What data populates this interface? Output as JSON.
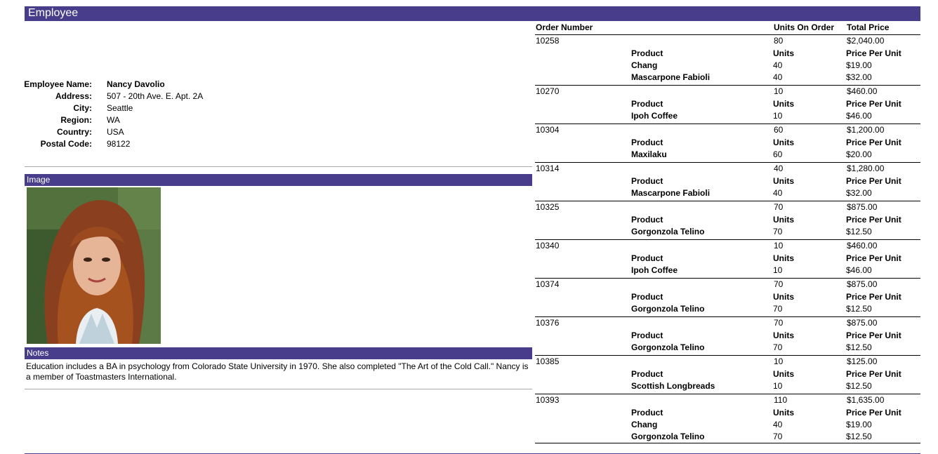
{
  "header": {
    "title": "Employee"
  },
  "employee": {
    "fields": [
      {
        "label": "Employee Name:",
        "value": "Nancy Davolio"
      },
      {
        "label": "Address:",
        "value": "507 - 20th Ave. E. Apt. 2A"
      },
      {
        "label": "City:",
        "value": "Seattle"
      },
      {
        "label": "Region:",
        "value": "WA"
      },
      {
        "label": "Country:",
        "value": "USA"
      },
      {
        "label": "Postal Code:",
        "value": "98122"
      }
    ]
  },
  "image_section": {
    "title": "Image"
  },
  "notes_section": {
    "title": "Notes",
    "text": "Education includes a BA in psychology from Colorado State University in 1970. She also completed \"The Art of the Cold Call.\" Nancy is a member of Toastmasters International."
  },
  "orders": {
    "headers": {
      "order_number": "Order Number",
      "units_on_order": "Units On Order",
      "total_price": "Total Price"
    },
    "detail_headers": {
      "product": "Product",
      "units": "Units",
      "price_per_unit": "Price Per Unit"
    },
    "list": [
      {
        "number": "10258",
        "units": "80",
        "total": "$2,040.00",
        "items": [
          {
            "product": "Chang",
            "units": "40",
            "price": "$19.00"
          },
          {
            "product": "Mascarpone Fabioli",
            "units": "40",
            "price": "$32.00"
          }
        ]
      },
      {
        "number": "10270",
        "units": "10",
        "total": "$460.00",
        "items": [
          {
            "product": "Ipoh Coffee",
            "units": "10",
            "price": "$46.00"
          }
        ]
      },
      {
        "number": "10304",
        "units": "60",
        "total": "$1,200.00",
        "items": [
          {
            "product": "Maxilaku",
            "units": "60",
            "price": "$20.00"
          }
        ]
      },
      {
        "number": "10314",
        "units": "40",
        "total": "$1,280.00",
        "items": [
          {
            "product": "Mascarpone Fabioli",
            "units": "40",
            "price": "$32.00"
          }
        ]
      },
      {
        "number": "10325",
        "units": "70",
        "total": "$875.00",
        "items": [
          {
            "product": "Gorgonzola Telino",
            "units": "70",
            "price": "$12.50"
          }
        ]
      },
      {
        "number": "10340",
        "units": "10",
        "total": "$460.00",
        "items": [
          {
            "product": "Ipoh Coffee",
            "units": "10",
            "price": "$46.00"
          }
        ]
      },
      {
        "number": "10374",
        "units": "70",
        "total": "$875.00",
        "items": [
          {
            "product": "Gorgonzola Telino",
            "units": "70",
            "price": "$12.50"
          }
        ]
      },
      {
        "number": "10376",
        "units": "70",
        "total": "$875.00",
        "items": [
          {
            "product": "Gorgonzola Telino",
            "units": "70",
            "price": "$12.50"
          }
        ]
      },
      {
        "number": "10385",
        "units": "10",
        "total": "$125.00",
        "items": [
          {
            "product": "Scottish Longbreads",
            "units": "10",
            "price": "$12.50"
          }
        ]
      },
      {
        "number": "10393",
        "units": "110",
        "total": "$1,635.00",
        "items": [
          {
            "product": "Chang",
            "units": "40",
            "price": "$19.00"
          },
          {
            "product": "Gorgonzola Telino",
            "units": "70",
            "price": "$12.50"
          }
        ]
      }
    ]
  },
  "colors": {
    "band": "#483d8b",
    "band_text": "#ffffff",
    "rule": "#a9a9a9"
  },
  "icons": {
    "photo": "employee-photo"
  }
}
